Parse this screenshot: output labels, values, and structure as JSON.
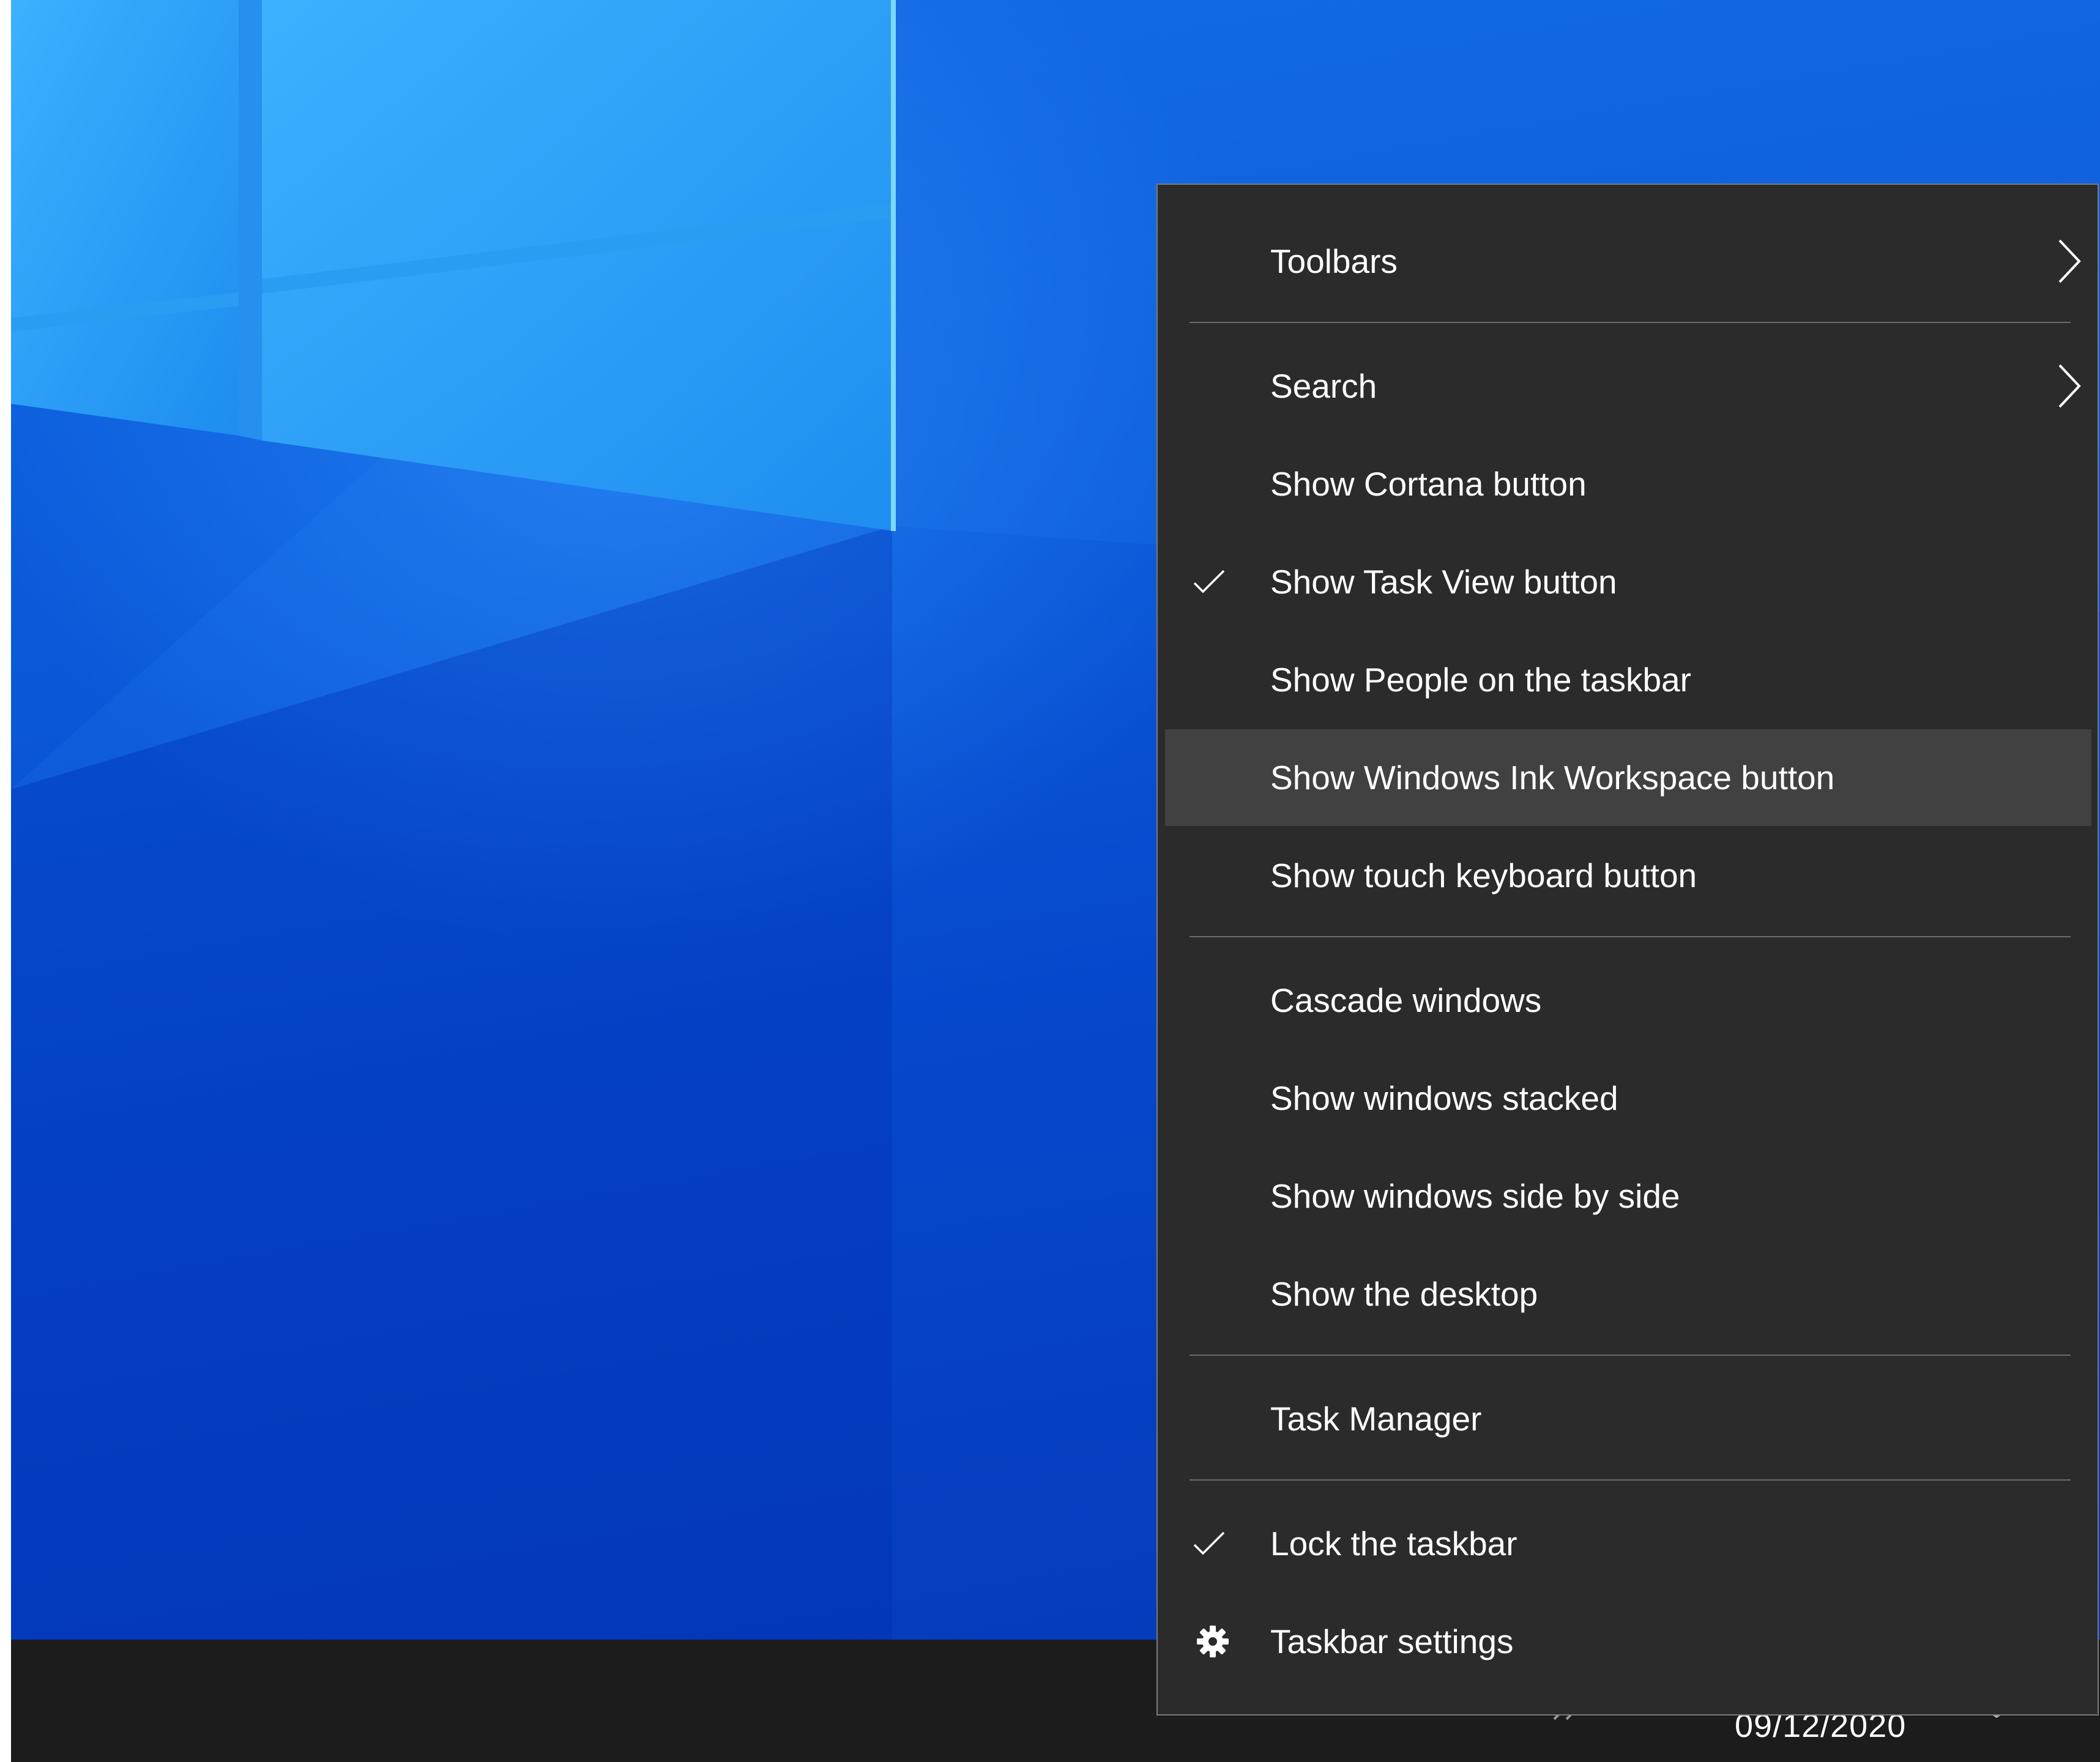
{
  "desktop": {
    "wallpaper": "windows-10-hero",
    "colors": {
      "wallpaper_blue": "#0a58d8",
      "logo_light": "#3fb4ff"
    }
  },
  "taskbar": {
    "date": "09/12/2020",
    "background": "#1c1c1c"
  },
  "context_menu": {
    "background": "#2b2b2b",
    "hover_background": "#414141",
    "items": [
      {
        "label": "Toolbars",
        "has_submenu": true,
        "checked": false
      },
      {
        "label": "Search",
        "has_submenu": true,
        "checked": false
      },
      {
        "label": "Show Cortana button",
        "has_submenu": false,
        "checked": false
      },
      {
        "label": "Show Task View button",
        "has_submenu": false,
        "checked": true
      },
      {
        "label": "Show People on the taskbar",
        "has_submenu": false,
        "checked": false
      },
      {
        "label": "Show Windows Ink Workspace button",
        "has_submenu": false,
        "checked": false,
        "highlighted": true
      },
      {
        "label": "Show touch keyboard button",
        "has_submenu": false,
        "checked": false
      },
      {
        "label": "Cascade windows",
        "has_submenu": false,
        "checked": false
      },
      {
        "label": "Show windows stacked",
        "has_submenu": false,
        "checked": false
      },
      {
        "label": "Show windows side by side",
        "has_submenu": false,
        "checked": false
      },
      {
        "label": "Show the desktop",
        "has_submenu": false,
        "checked": false
      },
      {
        "label": "Task Manager",
        "has_submenu": false,
        "checked": false
      },
      {
        "label": "Lock the taskbar",
        "has_submenu": false,
        "checked": true
      },
      {
        "label": "Taskbar settings",
        "has_submenu": false,
        "checked": false,
        "icon": "gear-icon"
      }
    ]
  }
}
